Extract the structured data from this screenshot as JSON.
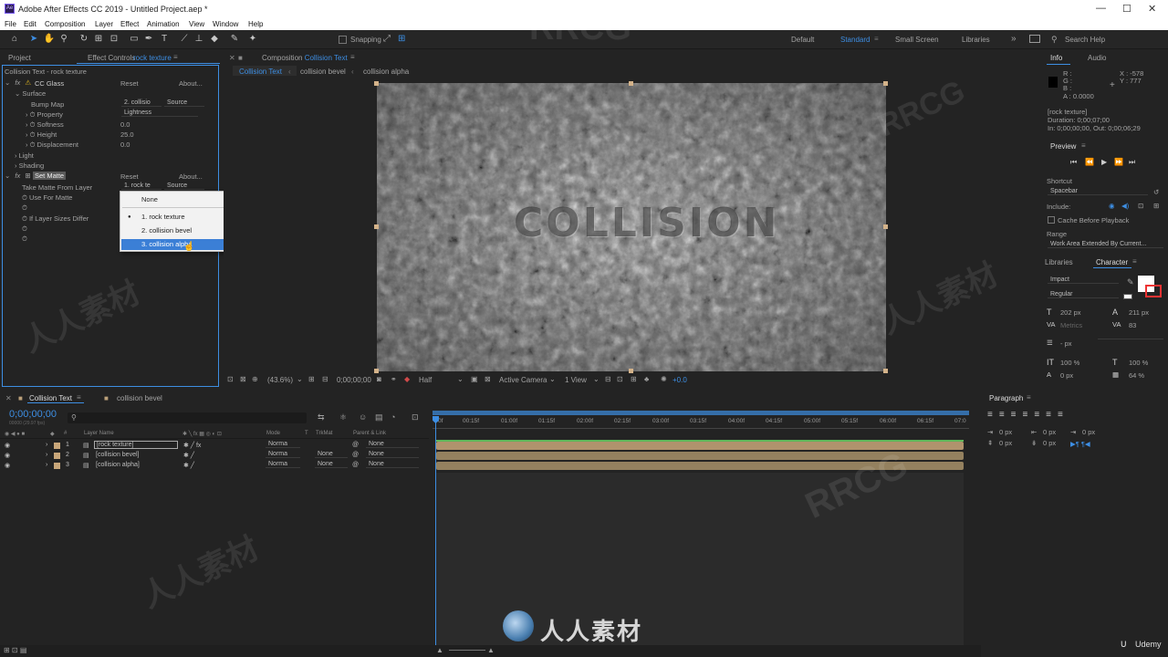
{
  "app": {
    "title": "Adobe After Effects CC 2019 - Untitled Project.aep *",
    "logo": "Ae"
  },
  "window_controls": {
    "min": "—",
    "max": "☐",
    "close": "✕"
  },
  "menu": [
    "File",
    "Edit",
    "Composition",
    "Layer",
    "Effect",
    "Animation",
    "View",
    "Window",
    "Help"
  ],
  "toolbar": {
    "snapping": "Snapping",
    "workspaces": [
      "Default",
      "Standard",
      "Small Screen",
      "Libraries"
    ],
    "active_workspace": "Standard",
    "search_placeholder": "Search Help"
  },
  "left_panel": {
    "tabs": [
      "Project",
      "Effect Controls"
    ],
    "effect_layer": "rock texture",
    "header": "Collision Text - rock texture",
    "cc_glass": {
      "name": "CC Glass",
      "reset": "Reset",
      "about": "About...",
      "surface": "Surface",
      "bump_map": "Bump Map",
      "bump_value": "2. collisio",
      "bump_src": "Source",
      "property": "Property",
      "property_value": "Lightness",
      "softness": "Softness",
      "softness_value": "0.0",
      "height": "Height",
      "height_value": "25.0",
      "displacement": "Displacement",
      "displacement_value": "0.0",
      "light": "Light",
      "shading": "Shading"
    },
    "set_matte": {
      "name": "Set Matte",
      "reset": "Reset",
      "about": "About...",
      "take_matte": "Take Matte From Layer",
      "take_value": "1. rock te",
      "take_src": "Source",
      "use_for_matte": "Use For Matte",
      "if_layer": "If Layer Sizes Differ"
    }
  },
  "dropdown": {
    "options": [
      "None",
      "1. rock texture",
      "2. collision bevel",
      "3. collision alpha"
    ],
    "checked_index": 1,
    "highlight_index": 3,
    "check_glyph": "●"
  },
  "composition": {
    "tab_prefix": "Composition",
    "tab_name": "Collision Text",
    "crumbs": [
      "Collision Text",
      "collision bevel",
      "collision alpha"
    ],
    "canvas_text": "COLLISION"
  },
  "viewer_bar": {
    "zoom": "(43.6%)",
    "timecode": "0;00;00;00",
    "resolution": "Half",
    "camera": "Active Camera",
    "views": "1 View",
    "exposure": "+0.0"
  },
  "info": {
    "tabs": [
      "Info",
      "Audio"
    ],
    "r": "R :",
    "g": "G :",
    "b": "B :",
    "a": "A : 0.0000",
    "x": "X : -578",
    "y": "Y : 777",
    "layer": "[rock texture]",
    "duration": "Duration: 0;00;07;00",
    "inout": "In: 0;00;00;00, Out: 0;00;06;29"
  },
  "preview": {
    "title": "Preview",
    "shortcut_label": "Shortcut",
    "shortcut": "Spacebar",
    "include": "Include:",
    "cache": "Cache Before Playback",
    "range_label": "Range",
    "range": "Work Area Extended By Current..."
  },
  "character": {
    "tabs": [
      "Libraries",
      "Character"
    ],
    "font": "Impact",
    "style": "Regular",
    "size": "202 px",
    "leading": "211 px",
    "kerning": "Metrics",
    "tracking": "83",
    "stroke": "- px",
    "vscale": "100 %",
    "hscale": "100 %",
    "baseline": "0 px",
    "tsume": "64 %"
  },
  "paragraph": {
    "title": "Paragraph",
    "values": [
      "0 px",
      "0 px",
      "0 px",
      "0 px",
      "0 px"
    ]
  },
  "timeline": {
    "tabs": [
      "Collision Text",
      "collision bevel"
    ],
    "timecode": "0;00;00;00",
    "fps": "00000 (29.97 fps)",
    "columns": {
      "num": "#",
      "name": "Layer Name",
      "mode": "Mode",
      "t": "T",
      "trkmat": "TrkMat",
      "parent": "Parent & Link"
    },
    "ruler": [
      "0f",
      "00:15f",
      "01:00f",
      "01:15f",
      "02:00f",
      "02:15f",
      "03:00f",
      "03:15f",
      "04:00f",
      "04:15f",
      "05:00f",
      "05:15f",
      "06:00f",
      "06:15f",
      "07:0"
    ],
    "layers": [
      {
        "num": "1",
        "name": "[rock texture]",
        "mode": "Norma",
        "trkmat": "",
        "parent": "None",
        "color": "#c9a77a"
      },
      {
        "num": "2",
        "name": "[collision bevel]",
        "mode": "Norma",
        "trkmat": "None",
        "parent": "None",
        "color": "#c9a77a"
      },
      {
        "num": "3",
        "name": "[collision alpha]",
        "mode": "Norma",
        "trkmat": "None",
        "parent": "None",
        "color": "#c9a77a"
      }
    ]
  },
  "watermarks": {
    "rrcg": "RRCG",
    "cn": "人人素材",
    "udemy": "Udemy"
  }
}
